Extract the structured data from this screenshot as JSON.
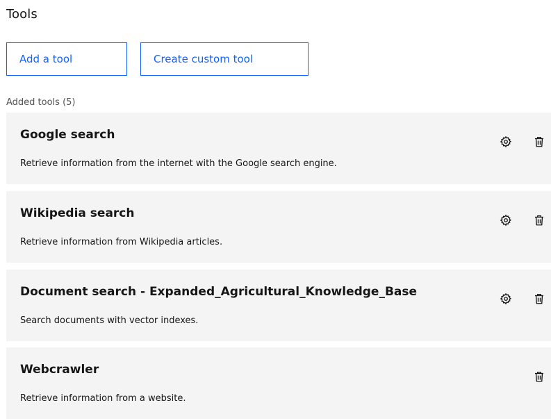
{
  "page": {
    "title": "Tools"
  },
  "actions": {
    "add_tool_label": "Add a tool",
    "create_custom_label": "Create custom tool"
  },
  "tools_section": {
    "label": "Added tools (5)"
  },
  "tools": [
    {
      "name": "Google search",
      "description": "Retrieve information from the internet with the Google search engine.",
      "has_settings": true
    },
    {
      "name": "Wikipedia search",
      "description": "Retrieve information from Wikipedia articles.",
      "has_settings": true
    },
    {
      "name": "Document search - Expanded_Agricultural_Knowledge_Base",
      "description": "Search documents with vector indexes.",
      "has_settings": true
    },
    {
      "name": "Webcrawler",
      "description": "Retrieve information from a website.",
      "has_settings": false
    }
  ],
  "icons": {
    "settings": "gear-icon",
    "delete": "trash-icon"
  },
  "colors": {
    "accent": "#0f62fe",
    "card_background": "#f4f4f4",
    "text_primary": "#161616",
    "text_secondary": "#525252"
  }
}
